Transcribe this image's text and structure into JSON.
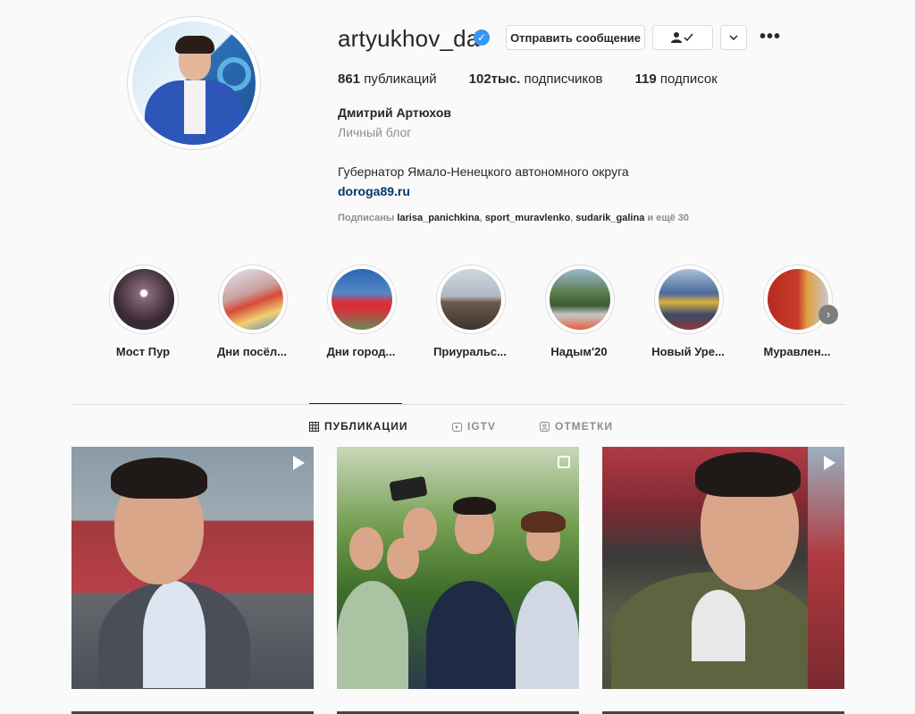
{
  "profile": {
    "username": "artyukhov_da",
    "verified": true,
    "buttons": {
      "message": "Отправить сообщение",
      "follow_icon": "person-check-icon",
      "dropdown_icon": "chevron-down-icon",
      "more": "•••"
    },
    "stats": {
      "posts_count": "861",
      "posts_label": "публикаций",
      "followers_count": "102тыс.",
      "followers_label": "подписчиков",
      "following_count": "119",
      "following_label": "подписок"
    },
    "full_name": "Дмитрий Артюхов",
    "category": "Личный блог",
    "bio": "Губернатор Ямало-Ненецкого автономного округа",
    "link": "doroga89.ru",
    "followed_by": {
      "prefix": "Подписаны",
      "users": [
        "larisa_panichkina",
        "sport_muravlenko",
        "sudarik_galina"
      ],
      "suffix": "и ещё 30"
    }
  },
  "highlights": [
    {
      "label": "Мост Пур",
      "color": "#5a4a55"
    },
    {
      "label": "Дни посёл...",
      "color": "#c0c6d8"
    },
    {
      "label": "Дни город...",
      "color": "#3b73b8"
    },
    {
      "label": "Приуральс...",
      "color": "#8a7a6a"
    },
    {
      "label": "Надым'20",
      "color": "#6a8a5a"
    },
    {
      "label": "Новый Уре...",
      "color": "#4a6a9a"
    },
    {
      "label": "Муравлен...",
      "color": "#b03020"
    }
  ],
  "tabs": [
    {
      "label": "ПУБЛИКАЦИИ",
      "icon": "grid-icon",
      "active": true
    },
    {
      "label": "IGTV",
      "icon": "igtv-icon",
      "active": false
    },
    {
      "label": "ОТМЕТКИ",
      "icon": "tagged-icon",
      "active": false
    }
  ],
  "posts": [
    {
      "type": "video",
      "icon": "video-icon"
    },
    {
      "type": "gallery",
      "icon": "gallery-icon"
    },
    {
      "type": "video",
      "icon": "video-icon"
    }
  ],
  "colors": {
    "background": "#fafafa",
    "verified": "#3897f0",
    "link": "#00376b",
    "muted": "#8e8e8e",
    "border": "#dbdbdb"
  }
}
